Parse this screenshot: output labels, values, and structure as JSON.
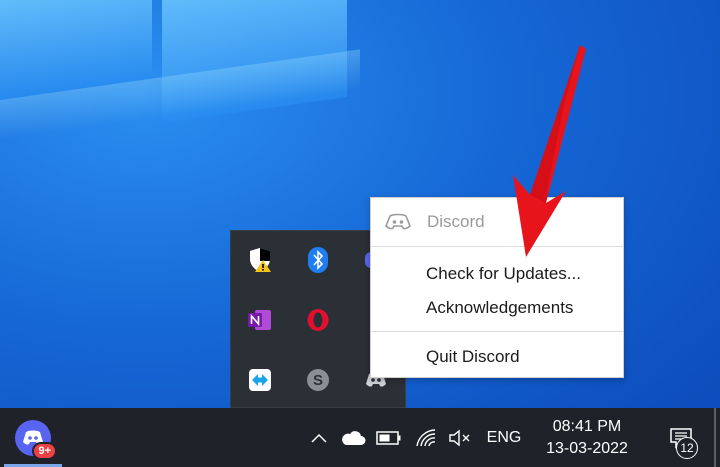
{
  "desktop": {
    "wallpaper": "windows-10-logo"
  },
  "context_menu": {
    "app_name": "Discord",
    "items": [
      {
        "label": "Check for Updates..."
      },
      {
        "label": "Acknowledgements"
      },
      {
        "label": "Quit Discord"
      }
    ]
  },
  "tray_flyout": {
    "icons": [
      "windows-security-warning-icon",
      "bluetooth-icon",
      "discord-tray-icon",
      "onenote-icon",
      "opera-icon",
      "unknown-icon",
      "teamviewer-icon",
      "skype-icon",
      "discord-icon"
    ]
  },
  "taskbar": {
    "start_app_badge": "9+",
    "language": "ENG",
    "time": "08:41 PM",
    "date": "13-03-2022",
    "notification_count": "12"
  },
  "colors": {
    "accent": "#5865f2",
    "arrow": "#e8141c",
    "taskbar": "#1f2329",
    "flyout": "#2b2f36"
  }
}
